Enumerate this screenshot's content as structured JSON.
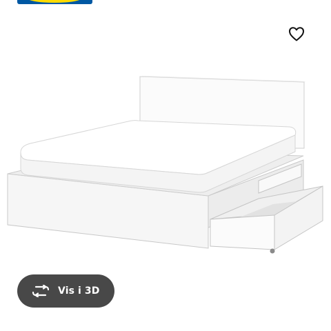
{
  "brand": {
    "logo_name": "ikea-logo",
    "colors": {
      "blue": "#0058a3",
      "yellow": "#ffdb00"
    }
  },
  "favorite": {
    "icon": "heart-icon"
  },
  "product": {
    "image_name": "bed-frame-with-storage-drawers",
    "color": "white"
  },
  "view3d": {
    "label": "Vis i 3D",
    "icon": "rotate-3d-icon",
    "background": "#484848",
    "text_color": "#ffffff"
  }
}
